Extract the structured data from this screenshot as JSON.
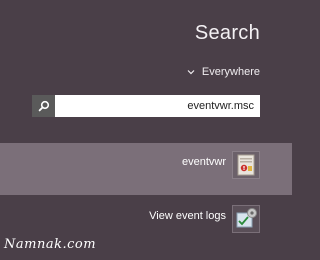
{
  "charm": {
    "title": "Search",
    "scope": {
      "label": "Everywhere",
      "chevron_icon": "chevron-down-icon"
    },
    "search": {
      "value": "eventvwr.msc",
      "button_icon": "search-icon"
    },
    "results": [
      {
        "label": "eventvwr",
        "icon": "event-viewer-icon",
        "selected": true
      },
      {
        "label": "View event logs",
        "icon": "control-panel-icon",
        "selected": false
      }
    ]
  },
  "watermark": {
    "text": "Namnak.com"
  },
  "colors": {
    "background": "#4a3f48",
    "selected_row": "#7b6f79",
    "search_button": "#5a5a5a",
    "text": "#ffffff"
  }
}
